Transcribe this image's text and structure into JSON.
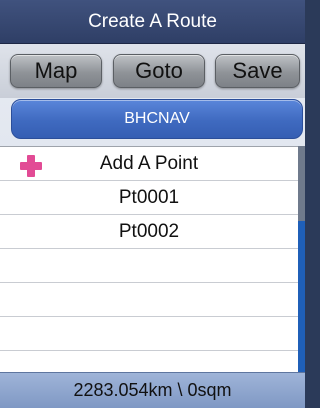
{
  "header": {
    "title": "Create A Route"
  },
  "toolbar": {
    "map_label": "Map",
    "goto_label": "Goto",
    "save_label": "Save"
  },
  "route": {
    "name": "BHCNAV"
  },
  "list": {
    "add_label": "Add A Point",
    "add_icon": "plus-icon",
    "points": [
      "Pt0001",
      "Pt0002"
    ]
  },
  "status": {
    "text": "2283.054km \\ 0sqm"
  },
  "colors": {
    "title_bar": "#2f3f66",
    "route_button": "#3f6ac0",
    "add_icon": "#e24b95",
    "status_bar": "#8ea6cf",
    "scroll_thumb": "#1f5fb8"
  }
}
